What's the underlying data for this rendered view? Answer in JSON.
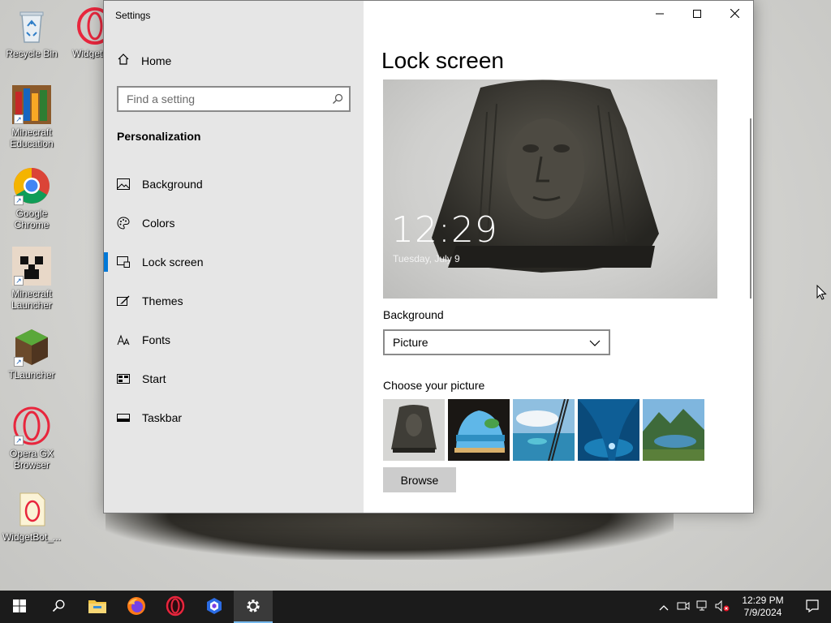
{
  "desktop": {
    "icons": [
      {
        "label": "Recycle Bin",
        "icon": "recycle-bin-icon"
      },
      {
        "label": "Widget",
        "icon": "opera-icon"
      },
      {
        "label": "Minecraft Education",
        "icon": "minecraft-education-icon"
      },
      {
        "label": "Google Chrome",
        "icon": "chrome-icon"
      },
      {
        "label": "Minecraft Launcher",
        "icon": "minecraft-launcher-icon"
      },
      {
        "label": "TLauncher",
        "icon": "tlauncher-icon"
      },
      {
        "label": "Opera GX Browser",
        "icon": "opera-gx-icon"
      },
      {
        "label": "WidgetBot_...",
        "icon": "file-icon"
      }
    ]
  },
  "window": {
    "title": "Settings",
    "caption": {
      "minimize": "minimize-icon",
      "maximize": "maximize-icon",
      "close": "close-icon"
    }
  },
  "sidebar": {
    "home_label": "Home",
    "search_placeholder": "Find a setting",
    "section_title": "Personalization",
    "items": [
      {
        "label": "Background",
        "icon": "picture-icon",
        "active": false
      },
      {
        "label": "Colors",
        "icon": "palette-icon",
        "active": false
      },
      {
        "label": "Lock screen",
        "icon": "lock-screen-icon",
        "active": true
      },
      {
        "label": "Themes",
        "icon": "themes-icon",
        "active": false
      },
      {
        "label": "Fonts",
        "icon": "fonts-icon",
        "active": false
      },
      {
        "label": "Start",
        "icon": "start-icon",
        "active": false
      },
      {
        "label": "Taskbar",
        "icon": "taskbar-icon",
        "active": false
      }
    ]
  },
  "main": {
    "title": "Lock screen",
    "preview": {
      "time": "12:29",
      "date": "Tuesday, July 9"
    },
    "background_label": "Background",
    "background_value": "Picture",
    "choose_label": "Choose your picture",
    "browse_label": "Browse"
  },
  "taskbar": {
    "apps": [
      "start-icon",
      "search-icon",
      "file-explorer-icon",
      "firefox-icon",
      "opera-icon",
      "copilot-icon",
      "settings-icon"
    ],
    "time": "12:29 PM",
    "date": "7/9/2024"
  },
  "colors": {
    "accent": "#0078d7",
    "sidebar_bg": "#e6e6e6",
    "taskbar_bg": "#1b1b1b"
  }
}
